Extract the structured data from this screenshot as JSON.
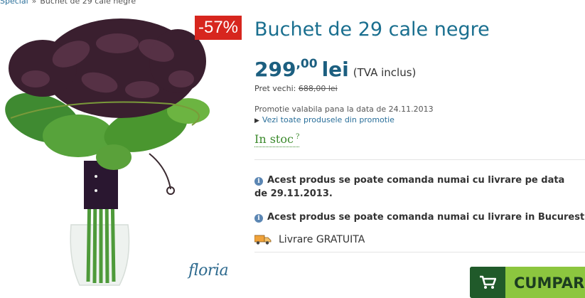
{
  "breadcrumb": {
    "items": [
      "Special",
      "Buchet de 29 cale negre"
    ],
    "separator": "»"
  },
  "product": {
    "image_alt": "Buchet de 29 cale negre",
    "discount": "-57%",
    "brand_logo": "floria",
    "title": "Buchet de 29 cale negre",
    "price": {
      "integer": "299",
      "decimal": ",00",
      "currency": "lei",
      "vat_note": "(TVA inclus)"
    },
    "old_price": {
      "label": "Pret vechi:",
      "value": "688,00 lei"
    },
    "promo_note": "Promotie valabila pana la data de 24.11.2013",
    "promo_link": "Vezi toate produsele din promotie",
    "stock": {
      "label": "In stoc",
      "help": "?"
    },
    "notices": [
      "Acest produs se poate comanda numai cu livrare pe data de 29.11.2013.",
      "Acest produs se poate comanda numai cu livrare in Bucuresti"
    ],
    "delivery": "Livrare GRATUITA",
    "buy_label": "CUMPAR"
  },
  "colors": {
    "accent_teal": "#1a6f8f",
    "badge_red": "#d7261e",
    "stock_green": "#3c8a2d",
    "button_green": "#8cc63f"
  }
}
